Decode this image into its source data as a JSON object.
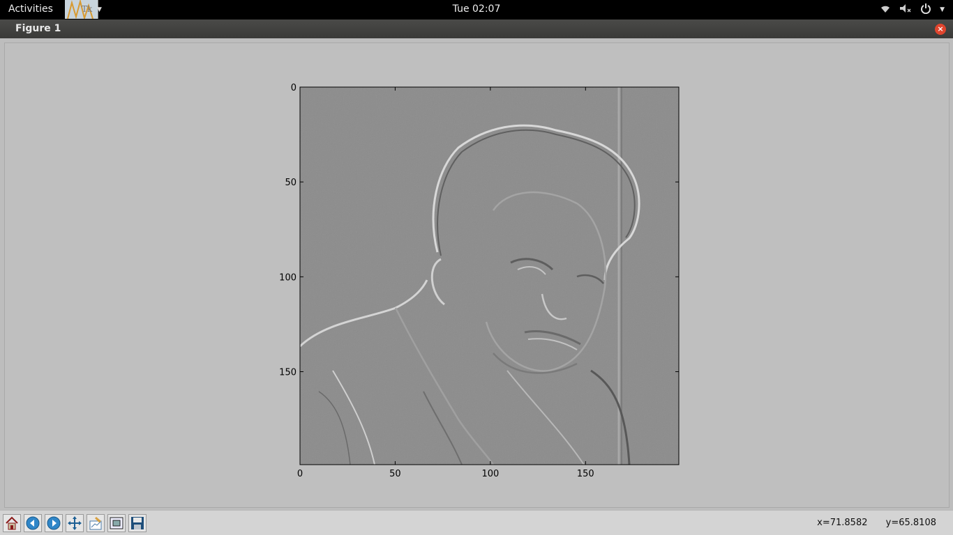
{
  "topbar": {
    "activities_label": "Activities",
    "app_label": "Tk",
    "clock": "Tue 02:07",
    "tray_icons": [
      "wifi-icon",
      "volume-muted-icon",
      "power-icon",
      "chevron-down-icon"
    ]
  },
  "window": {
    "title": "Figure 1",
    "close_label": "×"
  },
  "chart_data": {
    "type": "image",
    "description_hidden": false,
    "x_ticks": [
      "0",
      "50",
      "100",
      "150"
    ],
    "y_ticks": [
      "0",
      "50",
      "100",
      "150"
    ],
    "xlim": [
      0,
      199
    ],
    "ylim": [
      199,
      0
    ],
    "colormap": "gray"
  },
  "toolbar": {
    "buttons": [
      "home-icon",
      "back-icon",
      "forward-icon",
      "pan-icon",
      "configure-subplots-icon",
      "zoom-to-rect-icon",
      "save-icon"
    ],
    "x_readout": "x=71.8582",
    "y_readout": "y=65.8108"
  }
}
